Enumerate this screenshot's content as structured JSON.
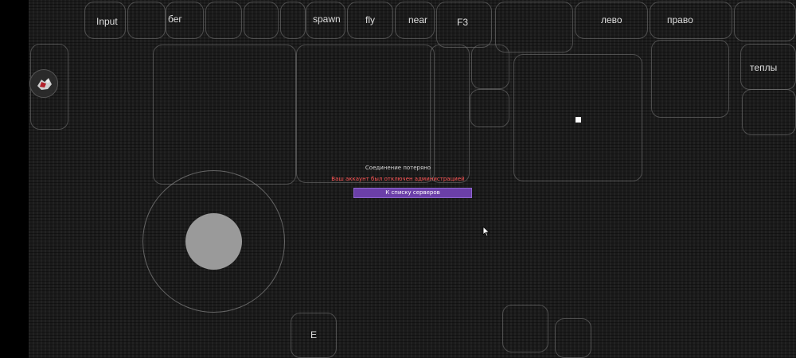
{
  "top_bar": {
    "input_label": "Input",
    "run_label": "бег",
    "spawn_label": "spawn",
    "fly_label": "fly",
    "near_label": "near",
    "f3_label": "F3",
    "left_label": "лево",
    "right_label": "право"
  },
  "side": {
    "tp_label": "тeплы"
  },
  "bottom": {
    "e_label": "E"
  },
  "dialog": {
    "title": "Соединение потеряно",
    "message": "Ваш аккаунт был отключен администрацией",
    "button_label": "К списку серверов",
    "title_color": "#d8d8d8",
    "message_color": "#ff5555",
    "button_color": "#6b3fa8"
  }
}
